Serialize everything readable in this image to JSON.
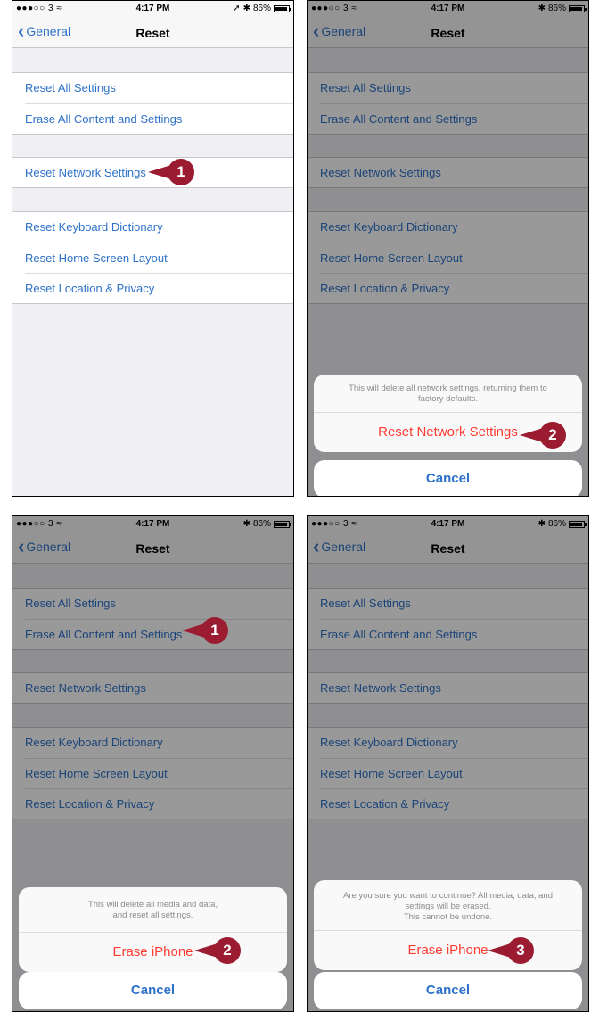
{
  "status": {
    "signal": "●●●○○ 3 ≈",
    "time": "4:17 PM",
    "battery": "86%",
    "bluetooth": "✱",
    "location": "➚"
  },
  "nav": {
    "back_label": "General",
    "title": "Reset"
  },
  "rows": {
    "reset_all": "Reset All Settings",
    "erase_all": "Erase All Content and Settings",
    "reset_network": "Reset Network Settings",
    "reset_keyboard": "Reset Keyboard Dictionary",
    "reset_home": "Reset Home Screen Layout",
    "reset_location": "Reset Location & Privacy"
  },
  "sheet_network": {
    "message_line1": "This will delete all network settings, returning them to",
    "message_line2": "factory defaults.",
    "action": "Reset Network Settings",
    "cancel": "Cancel"
  },
  "sheet_erase": {
    "message_line1": "This will delete all media and data,",
    "message_line2": "and reset all settings.",
    "action": "Erase iPhone",
    "cancel": "Cancel"
  },
  "sheet_confirm": {
    "message_line1": "Are you sure you want to continue? All media, data, and",
    "message_line2": "settings will be erased.",
    "message_line3": "This cannot be undone.",
    "action": "Erase iPhone",
    "cancel": "Cancel"
  },
  "callouts": {
    "one": "1",
    "two": "2",
    "three": "3"
  },
  "colors": {
    "link": "#2e72c9",
    "destructive": "#fe3b30",
    "callout": "#9b1b30"
  }
}
